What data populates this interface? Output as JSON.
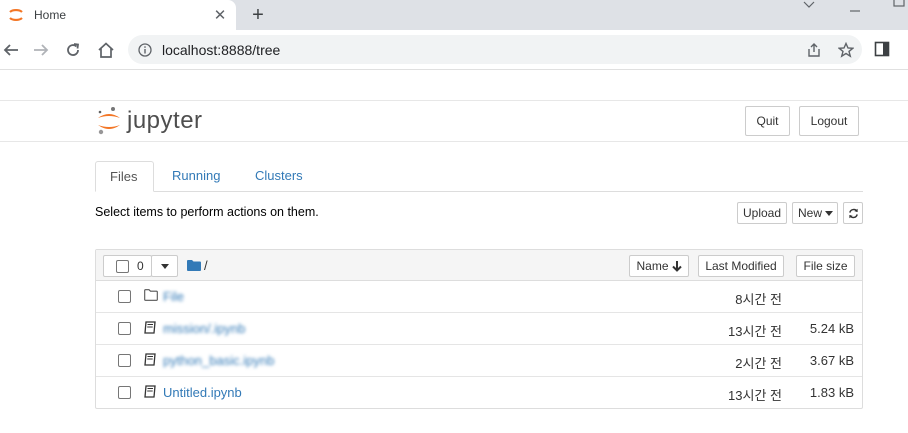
{
  "browser": {
    "tab_title": "Home",
    "url": "localhost:8888/tree"
  },
  "header": {
    "brand": "jupyter",
    "quit_label": "Quit",
    "logout_label": "Logout"
  },
  "tabs": [
    {
      "label": "Files"
    },
    {
      "label": "Running"
    },
    {
      "label": "Clusters"
    }
  ],
  "hint": "Select items to perform actions on them.",
  "actions": {
    "upload_label": "Upload",
    "new_label": "New"
  },
  "list_header": {
    "selected_count": "0",
    "path": "/",
    "sort_name_label": "Name",
    "last_modified_label": "Last Modified",
    "file_size_label": "File size"
  },
  "files": [
    {
      "name": "File",
      "modified": "8시간 전",
      "size": "",
      "type": "folder"
    },
    {
      "name": "mission/.ipynb",
      "modified": "13시간 전",
      "size": "5.24 kB",
      "type": "notebook"
    },
    {
      "name": "python_basic.ipynb",
      "modified": "2시간 전",
      "size": "3.67 kB",
      "type": "notebook"
    },
    {
      "name": "Untitled.ipynb",
      "modified": "13시간 전",
      "size": "1.83 kB",
      "type": "notebook"
    }
  ],
  "colors": {
    "link": "#337ab7",
    "jupyter_orange": "#f37626"
  }
}
